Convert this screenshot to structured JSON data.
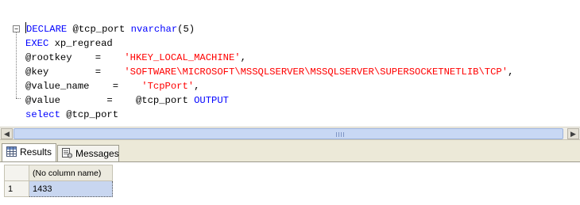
{
  "editor": {
    "lines": [
      {
        "parts": [
          {
            "text": "DECLARE",
            "cls": "kw"
          },
          {
            "text": " @tcp_port ",
            "cls": ""
          },
          {
            "text": "nvarchar",
            "cls": "kw"
          },
          {
            "text": "(5)",
            "cls": ""
          }
        ]
      },
      {
        "parts": [
          {
            "text": "EXEC",
            "cls": "kw"
          },
          {
            "text": " xp_regread",
            "cls": ""
          }
        ]
      },
      {
        "parts": [
          {
            "text": "@rootkey    =    ",
            "cls": ""
          },
          {
            "text": "'HKEY_LOCAL_MACHINE'",
            "cls": "str"
          },
          {
            "text": ",",
            "cls": ""
          }
        ]
      },
      {
        "parts": [
          {
            "text": "@key        =    ",
            "cls": ""
          },
          {
            "text": "'SOFTWARE\\MICROSOFT\\MSSQLSERVER\\MSSQLSERVER\\SUPERSOCKETNETLIB\\TCP'",
            "cls": "str"
          },
          {
            "text": ",",
            "cls": ""
          }
        ]
      },
      {
        "parts": [
          {
            "text": "@value_name    =    ",
            "cls": ""
          },
          {
            "text": "'TcpPort'",
            "cls": "str"
          },
          {
            "text": ",",
            "cls": ""
          }
        ]
      },
      {
        "parts": [
          {
            "text": "@value        =    @tcp_port ",
            "cls": ""
          },
          {
            "text": "OUTPUT",
            "cls": "kw"
          }
        ]
      },
      {
        "parts": [
          {
            "text": "select",
            "cls": "kw"
          },
          {
            "text": " @tcp_port",
            "cls": ""
          }
        ]
      }
    ]
  },
  "tabs": {
    "results_label": "Results",
    "messages_label": "Messages"
  },
  "results": {
    "column_header": "(No column name)",
    "rows": [
      {
        "row_number": "1",
        "value": "1433"
      }
    ]
  },
  "icons": {
    "results_tab": "grid-icon",
    "messages_tab": "messages-icon",
    "scroll_left": "arrow-left-icon",
    "scroll_right": "arrow-right-icon"
  },
  "colors": {
    "keyword": "#0000ff",
    "string": "#ff0000",
    "selected_cell": "#c8d6f0"
  }
}
